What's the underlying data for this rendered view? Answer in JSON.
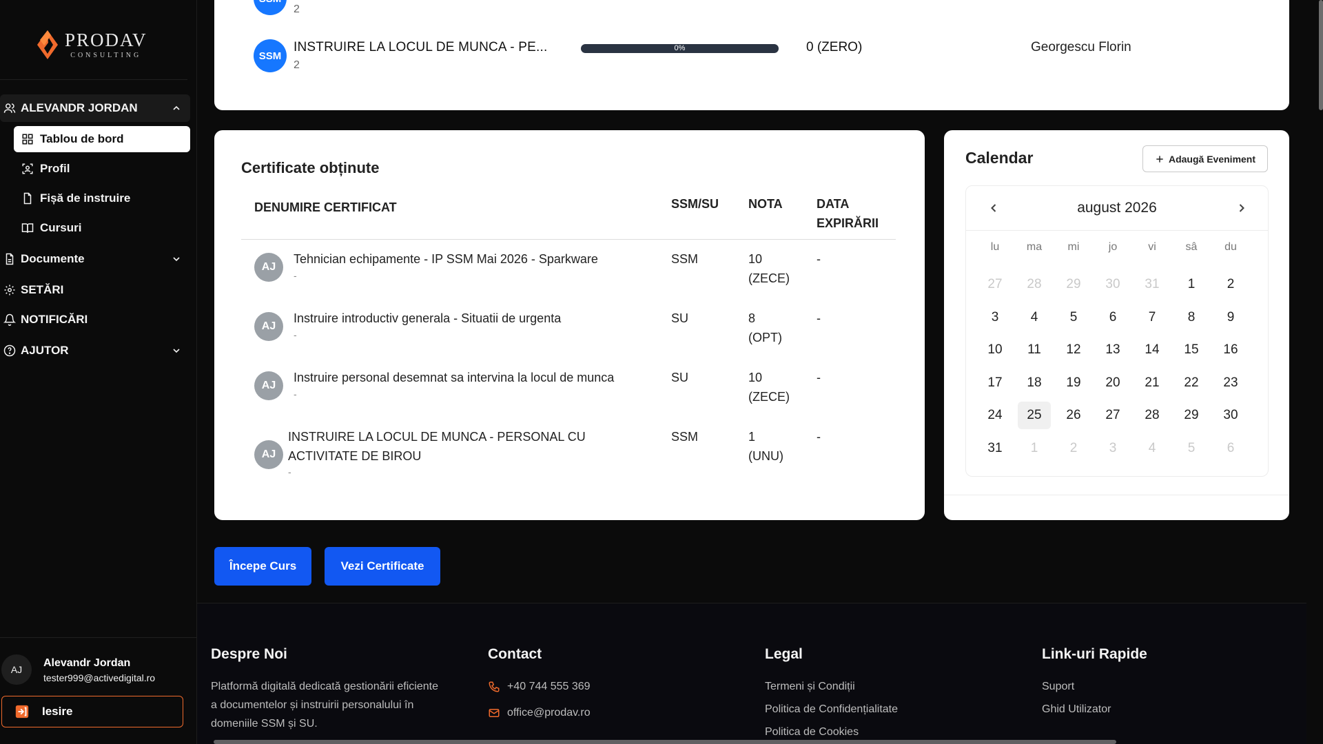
{
  "brand": {
    "name": "PRODAV",
    "sub": "CONSULTING",
    "accent": "#f06a2c"
  },
  "sidebar": {
    "user_section": "ALEVANDR JORDAN",
    "items": [
      {
        "label": "Tablou de bord"
      },
      {
        "label": "Profil"
      },
      {
        "label": "Fișă de instruire"
      },
      {
        "label": "Cursuri"
      }
    ],
    "documents": "Documente",
    "settings": "SETĂRI",
    "notifications": "NOTIFICĂRI",
    "help": "AJUTOR",
    "user": {
      "initials": "AJ",
      "name": "Alevandr Jordan",
      "email": "tester999@activedigital.ro"
    },
    "logout": "Iesire"
  },
  "courses": {
    "partial": {
      "badge": "SSM",
      "sub": "2"
    },
    "row": {
      "badge": "SSM",
      "title": "INSTRUIRE LA LOCUL DE MUNCA - PE...",
      "sub": "2",
      "progress_label": "0%",
      "progress": 0,
      "score": "0 (ZERO)",
      "instructor": "Georgescu Florin"
    }
  },
  "certificates": {
    "heading": "Certificate obținute",
    "headers": {
      "name": "DENUMIRE CERTIFICAT",
      "type": "SSM/SU",
      "grade": "NOTA",
      "expiry_1": "DATA",
      "expiry_2": "EXPIRĂRII"
    },
    "rows": [
      {
        "initials": "AJ",
        "name": "Tehnician echipamente - IP SSM Mai 2026 - Sparkware",
        "name2": "",
        "sub": "-",
        "type": "SSM",
        "grade1": "10",
        "grade2": "(ZECE)",
        "expiry": "-"
      },
      {
        "initials": "AJ",
        "name": "Instruire introductiv generala - Situatii de urgenta",
        "name2": "",
        "sub": "-",
        "type": "SU",
        "grade1": "8",
        "grade2": "(OPT)",
        "expiry": "-"
      },
      {
        "initials": "AJ",
        "name": "Instruire personal desemnat sa intervina la locul de munca",
        "name2": "",
        "sub": "-",
        "type": "SU",
        "grade1": "10",
        "grade2": "(ZECE)",
        "expiry": "-"
      },
      {
        "initials": "AJ",
        "name": "INSTRUIRE LA LOCUL DE MUNCA - PERSONAL CU",
        "name2": "ACTIVITATE DE BIROU",
        "sub": "-",
        "type": "SSM",
        "grade1": "1",
        "grade2": "(UNU)",
        "expiry": "-"
      }
    ]
  },
  "calendar": {
    "title": "Calendar",
    "add_event": "Adaugă Eveniment",
    "month": "august 2026",
    "weekdays": [
      "lu",
      "ma",
      "mi",
      "jo",
      "vi",
      "sâ",
      "du"
    ],
    "weeks": [
      [
        "27",
        "28",
        "29",
        "30",
        "31",
        "1",
        "2"
      ],
      [
        "3",
        "4",
        "5",
        "6",
        "7",
        "8",
        "9"
      ],
      [
        "10",
        "11",
        "12",
        "13",
        "14",
        "15",
        "16"
      ],
      [
        "17",
        "18",
        "19",
        "20",
        "21",
        "22",
        "23"
      ],
      [
        "24",
        "25",
        "26",
        "27",
        "28",
        "29",
        "30"
      ],
      [
        "31",
        "1",
        "2",
        "3",
        "4",
        "5",
        "6"
      ]
    ],
    "today": "25"
  },
  "actions": {
    "start": "Începe Curs",
    "certs": "Vezi Certificate"
  },
  "footer": {
    "about_title": "Despre Noi",
    "about_lines": [
      "Platformă digitală dedicată gestionării eficiente",
      "a documentelor și instruirii personalului în",
      "domeniile SSM și SU."
    ],
    "contact_title": "Contact",
    "phone": "+40 744 555 369",
    "email": "office@prodav.ro",
    "legal_title": "Legal",
    "legal": [
      "Termeni și Condiții",
      "Politica de Confidențialitate",
      "Politica de Cookies"
    ],
    "quick_title": "Link-uri Rapide",
    "quick": [
      "Suport",
      "Ghid Utilizator"
    ]
  }
}
